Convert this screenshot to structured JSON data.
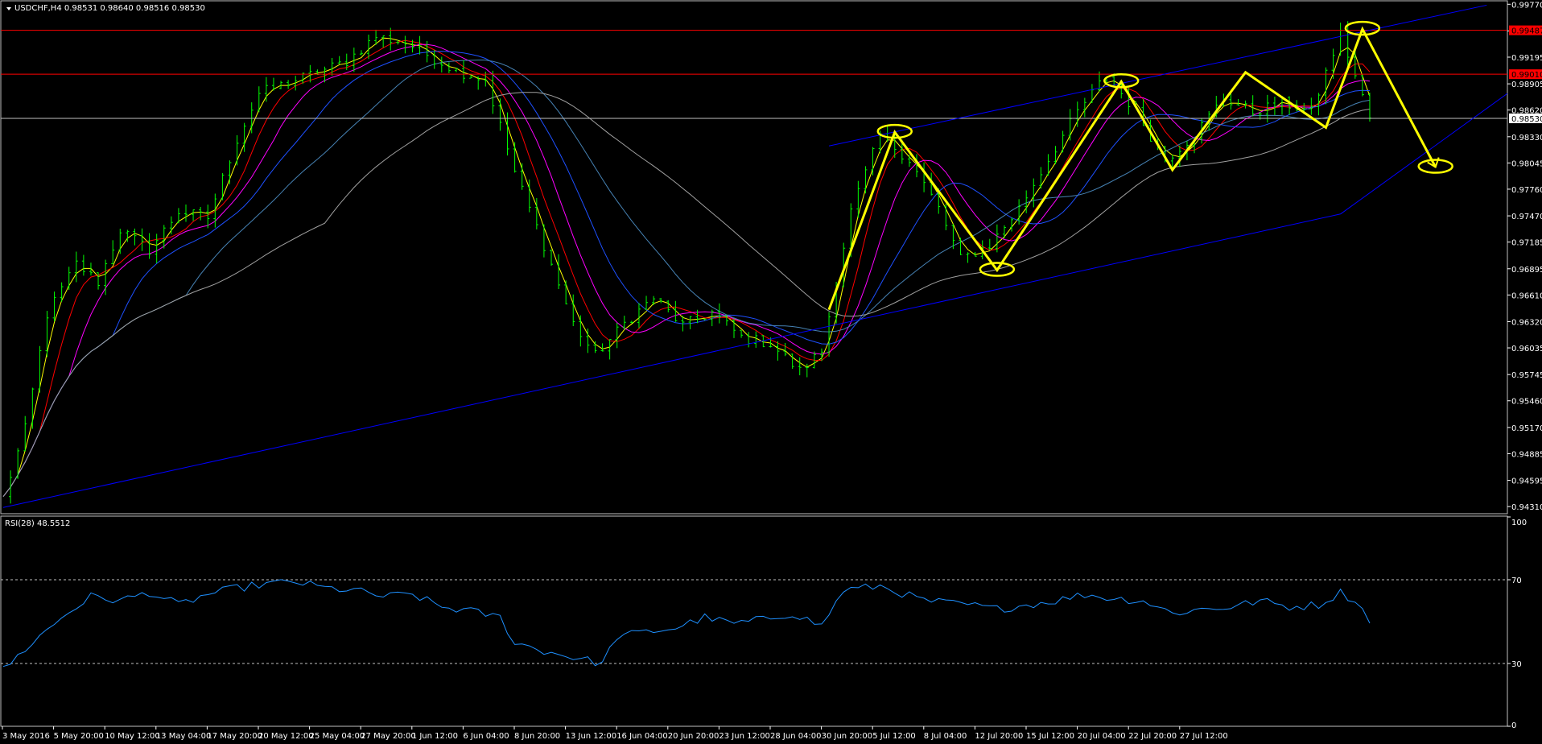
{
  "header": {
    "symbol_line": "USDCHF,H4  0.98531 0.98640 0.98516 0.98530",
    "indicator_line": "RSI(28) 48.5512"
  },
  "colors": {
    "background": "#000000",
    "candles": "#00ff00",
    "price_line": "#c0c0c0",
    "resistance": "#ff0000",
    "channel": "#0000ff",
    "pattern": "#ffff00",
    "ma_fast": "#ffff00",
    "ma_red": "#ff0000",
    "ma_magenta": "#ff00ff",
    "ma_blue": "#1e50ff",
    "ma_steelblue": "#4682b4",
    "ma_gray": "#a0a0a0",
    "rsi_line": "#1e90ff",
    "rsi_levels": "#c0c0c0",
    "axis_text": "#ffffff"
  },
  "chart_data": [
    {
      "type": "candlestick",
      "title": "USDCHF,H4",
      "ohlc_current": {
        "open": 0.98531,
        "high": 0.9864,
        "low": 0.98516,
        "close": 0.9853
      },
      "current_price_label": "0.98530",
      "ylim": [
        0.9425,
        0.9979
      ],
      "y_ticks": [
        "0.99770",
        "0.99480",
        "0.99195",
        "0.98905",
        "0.98620",
        "0.98330",
        "0.98045",
        "0.97760",
        "0.97470",
        "0.97185",
        "0.96895",
        "0.96610",
        "0.96320",
        "0.96035",
        "0.95745",
        "0.95460",
        "0.95170",
        "0.94885",
        "0.94595",
        "0.94310"
      ],
      "x_ticks": [
        "3 May 2016",
        "5 May 20:00",
        "10 May 12:00",
        "13 May 04:00",
        "17 May 20:00",
        "20 May 12:00",
        "25 May 04:00",
        "27 May 20:00",
        "1 Jun 12:00",
        "6 Jun 04:00",
        "8 Jun 20:00",
        "13 Jun 12:00",
        "16 Jun 04:00",
        "20 Jun 20:00",
        "23 Jun 12:00",
        "28 Jun 04:00",
        "30 Jun 20:00",
        "5 Jul 12:00",
        "8 Jul 04:00",
        "12 Jul 20:00",
        "15 Jul 12:00",
        "20 Jul 04:00",
        "22 Jul 20:00",
        "27 Jul 12:00"
      ],
      "price_path": [
        [
          0,
          0.944
        ],
        [
          3,
          0.9515
        ],
        [
          6,
          0.964
        ],
        [
          10,
          0.9695
        ],
        [
          13,
          0.9675
        ],
        [
          16,
          0.9732
        ],
        [
          20,
          0.971
        ],
        [
          24,
          0.9752
        ],
        [
          28,
          0.9745
        ],
        [
          32,
          0.983
        ],
        [
          35,
          0.988
        ],
        [
          39,
          0.9892
        ],
        [
          43,
          0.9903
        ],
        [
          47,
          0.9915
        ],
        [
          51,
          0.9942
        ],
        [
          55,
          0.9935
        ],
        [
          59,
          0.9918
        ],
        [
          62,
          0.9905
        ],
        [
          66,
          0.9895
        ],
        [
          70,
          0.9795
        ],
        [
          74,
          0.9715
        ],
        [
          78,
          0.963
        ],
        [
          81,
          0.9595
        ],
        [
          85,
          0.963
        ],
        [
          89,
          0.9658
        ],
        [
          93,
          0.9628
        ],
        [
          97,
          0.9642
        ],
        [
          101,
          0.9615
        ],
        [
          105,
          0.9608
        ],
        [
          109,
          0.9578
        ],
        [
          112,
          0.96
        ],
        [
          116,
          0.9752
        ],
        [
          120,
          0.9835
        ],
        [
          124,
          0.9808
        ],
        [
          128,
          0.9755
        ],
        [
          131,
          0.97
        ],
        [
          135,
          0.9715
        ],
        [
          139,
          0.9755
        ],
        [
          143,
          0.9808
        ],
        [
          147,
          0.986
        ],
        [
          151,
          0.99
        ],
        [
          155,
          0.986
        ],
        [
          159,
          0.9808
        ],
        [
          163,
          0.9835
        ],
        [
          167,
          0.9875
        ],
        [
          171,
          0.986
        ],
        [
          175,
          0.987
        ],
        [
          179,
          0.986
        ],
        [
          183,
          0.9945
        ],
        [
          187,
          0.9853
        ]
      ],
      "resistance_levels": [
        {
          "value": 0.99487,
          "label": "0.99487"
        },
        {
          "value": 0.9901,
          "label": "0.99010"
        }
      ],
      "channel_lines": [
        {
          "from": [
            0,
            0.943
          ],
          "to": [
            183,
            0.9749
          ]
        },
        {
          "from": [
            183,
            0.9749
          ],
          "to": [
            240,
            0.988
          ]
        },
        {
          "from": [
            113,
            0.9823
          ],
          "to": [
            203,
            0.9976
          ]
        }
      ],
      "pattern_zigzag": [
        [
          113,
          0.9645
        ],
        [
          122,
          0.9838
        ],
        [
          136,
          0.9688
        ],
        [
          153,
          0.9893
        ],
        [
          160,
          0.9797
        ],
        [
          170,
          0.9903
        ],
        [
          181,
          0.9843
        ],
        [
          186,
          0.995
        ],
        [
          196,
          0.98
        ]
      ],
      "pattern_highlights": [
        [
          122,
          0.9838
        ],
        [
          136,
          0.9688
        ],
        [
          153,
          0.9893
        ],
        [
          186,
          0.995
        ],
        [
          196,
          0.98
        ]
      ]
    },
    {
      "type": "line",
      "title": "RSI(28) 48.5512",
      "ylim": [
        0,
        100
      ],
      "y_ticks": [
        "100",
        "70",
        "30",
        "0"
      ],
      "levels": [
        70,
        30
      ],
      "series": [
        {
          "values": [
            [
              0,
              27
            ],
            [
              4,
              40
            ],
            [
              8,
              52
            ],
            [
              12,
              62
            ],
            [
              16,
              60
            ],
            [
              20,
              64
            ],
            [
              24,
              58
            ],
            [
              28,
              63
            ],
            [
              32,
              66
            ],
            [
              36,
              68
            ],
            [
              40,
              69
            ],
            [
              44,
              66
            ],
            [
              48,
              65
            ],
            [
              52,
              62
            ],
            [
              56,
              63
            ],
            [
              60,
              57
            ],
            [
              64,
              55
            ],
            [
              68,
              52
            ],
            [
              70,
              40
            ],
            [
              74,
              36
            ],
            [
              78,
              33
            ],
            [
              82,
              30
            ],
            [
              84,
              43
            ],
            [
              88,
              45
            ],
            [
              92,
              47
            ],
            [
              96,
              52
            ],
            [
              100,
              49
            ],
            [
              104,
              51
            ],
            [
              108,
              54
            ],
            [
              112,
              48
            ],
            [
              115,
              65
            ],
            [
              120,
              67
            ],
            [
              126,
              60
            ],
            [
              132,
              58
            ],
            [
              136,
              56
            ],
            [
              140,
              58
            ],
            [
              144,
              60
            ],
            [
              148,
              63
            ],
            [
              152,
              61
            ],
            [
              156,
              60
            ],
            [
              160,
              54
            ],
            [
              164,
              56
            ],
            [
              168,
              57
            ],
            [
              172,
              60
            ],
            [
              176,
              57
            ],
            [
              180,
              58
            ],
            [
              183,
              64
            ],
            [
              185,
              60
            ],
            [
              187,
              51
            ]
          ]
        }
      ]
    }
  ]
}
